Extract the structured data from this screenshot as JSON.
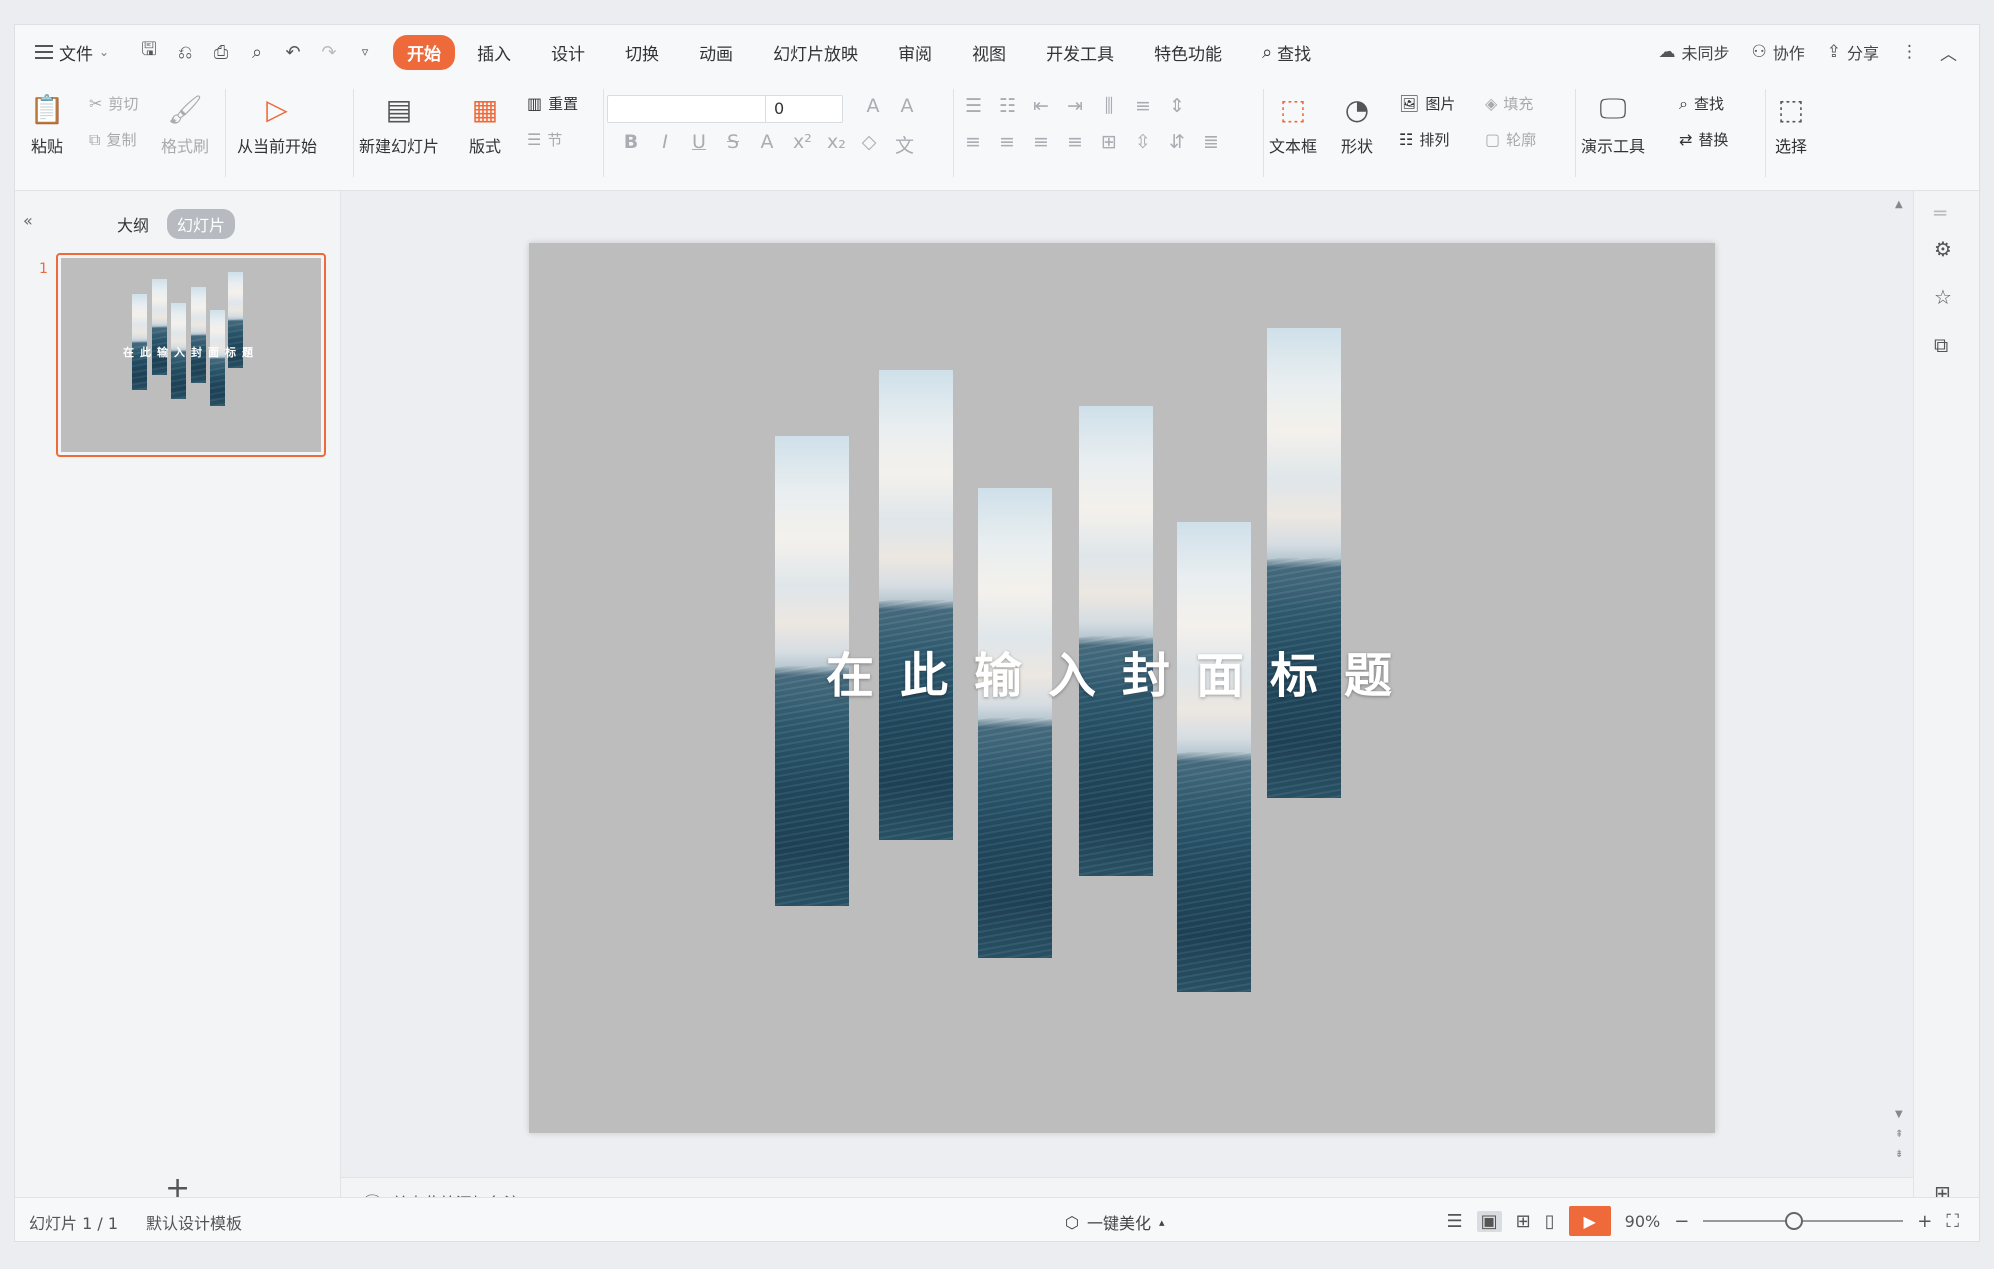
{
  "menubar": {
    "file_label": "文件",
    "tabs": [
      "开始",
      "插入",
      "设计",
      "切换",
      "动画",
      "幻灯片放映",
      "审阅",
      "视图",
      "开发工具",
      "特色功能"
    ],
    "active_tab": "开始",
    "search_label": "查找",
    "right": {
      "sync": "未同步",
      "collab": "协作",
      "share": "分享"
    }
  },
  "ribbon": {
    "paste": "粘贴",
    "cut": "剪切",
    "copy": "复制",
    "format_painter": "格式刷",
    "from_current": "从当前开始",
    "new_slide": "新建幻灯片",
    "layout": "版式",
    "reset": "重置",
    "section": "节",
    "font_size": "0",
    "text_box": "文本框",
    "shape": "形状",
    "picture": "图片",
    "fill": "填充",
    "arrange": "排列",
    "outline": "轮廓",
    "present_tools": "演示工具",
    "find": "查找",
    "replace": "替换",
    "select": "选择",
    "wen": "文"
  },
  "leftpane": {
    "outline_tab": "大纲",
    "slides_tab": "幻灯片",
    "slide_number": "1",
    "thumb_title": "在此输入封面标题"
  },
  "slide": {
    "title": "在此输入封面标题"
  },
  "notes": {
    "placeholder": "单击此处添加备注"
  },
  "statusbar": {
    "slide_info": "幻灯片 1 / 1",
    "template": "默认设计模板",
    "beautify": "一键美化",
    "zoom": "90%"
  },
  "colors": {
    "accent": "#ef6a3a",
    "slide_bg": "#bdbdbd"
  }
}
